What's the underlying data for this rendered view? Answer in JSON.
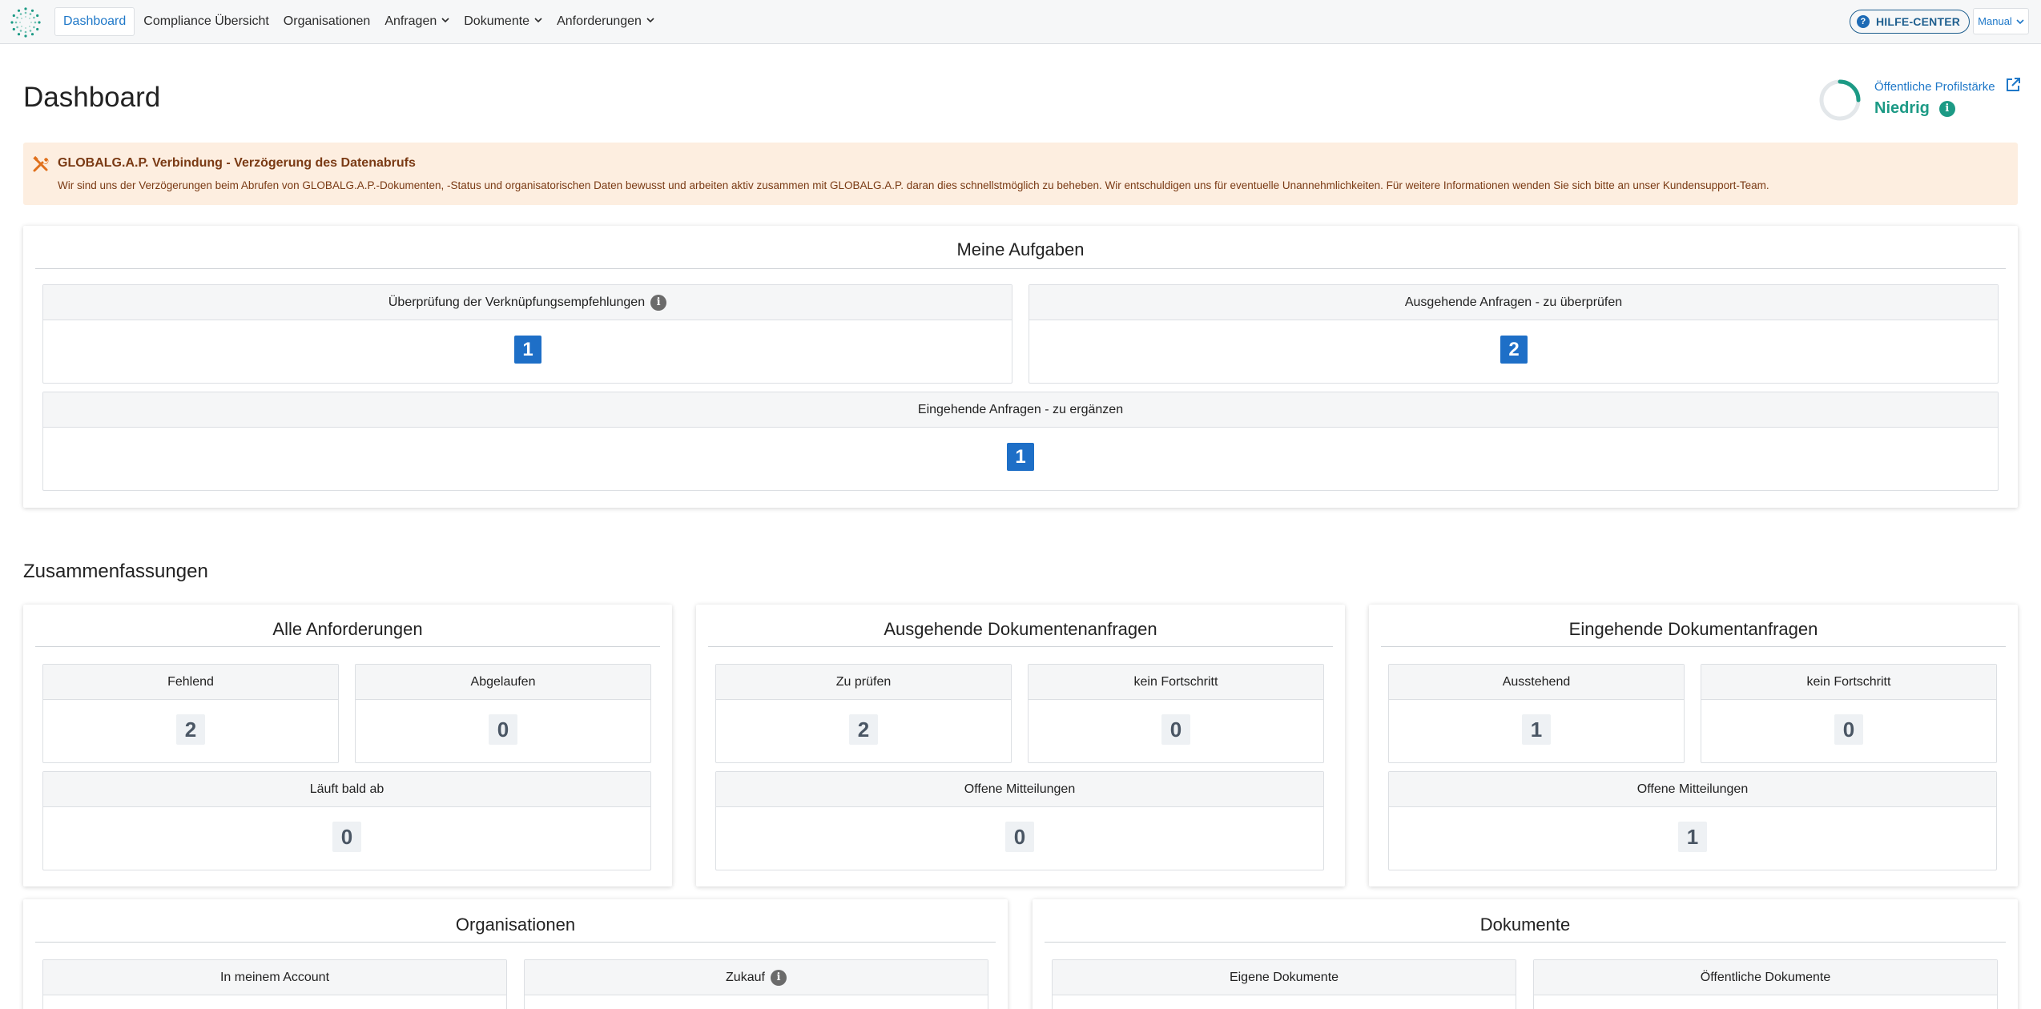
{
  "nav": {
    "items": [
      {
        "label": "Dashboard"
      },
      {
        "label": "Compliance Übersicht"
      },
      {
        "label": "Organisationen"
      },
      {
        "label": "Anfragen"
      },
      {
        "label": "Dokumente"
      },
      {
        "label": "Anforderungen"
      }
    ],
    "help_label": "HILFE-CENTER",
    "help_icon": "?",
    "manual_label": "Manual"
  },
  "header": {
    "title": "Dashboard",
    "profile_link": "Öffentliche Profilstärke",
    "profile_level": "Niedrig",
    "profile_progress": 0.25,
    "info_glyph": "i"
  },
  "alert": {
    "title": "GLOBALG.A.P. Verbindung - Verzögerung des Datenabrufs",
    "text": "Wir sind uns der Verzögerungen beim Abrufen von GLOBALG.A.P.-Dokumenten, -Status und organisatorischen Daten bewusst und arbeiten aktiv zusammen mit GLOBALG.A.P. daran dies schnellstmöglich zu beheben. Wir entschuldigen uns für eventuelle Unannehmlichkeiten. Für weitere Informationen wenden Sie sich bitte an unser Kundensupport-Team."
  },
  "tasks": {
    "title": "Meine Aufgaben",
    "tiles": [
      {
        "label": "Überprüfung der Verknüpfungsempfehlungen",
        "value": "1"
      },
      {
        "label": "Ausgehende Anfragen - zu überprüfen",
        "value": "2"
      },
      {
        "label": "Eingehende Anfragen - zu ergänzen",
        "value": "1"
      }
    ]
  },
  "summaries": {
    "title": "Zusammenfassungen",
    "all_requirements": {
      "title": "Alle Anforderungen",
      "tiles": [
        {
          "label": "Fehlend",
          "value": "2"
        },
        {
          "label": "Abgelaufen",
          "value": "0"
        },
        {
          "label": "Läuft bald ab",
          "value": "0"
        }
      ]
    },
    "outgoing_requests": {
      "title": "Ausgehende Dokumentenanfragen",
      "tiles": [
        {
          "label": "Zu prüfen",
          "value": "2"
        },
        {
          "label": "kein Fortschritt",
          "value": "0"
        },
        {
          "label": "Offene Mitteilungen",
          "value": "0"
        }
      ]
    },
    "incoming_requests": {
      "title": "Eingehende Dokumentanfragen",
      "tiles": [
        {
          "label": "Ausstehend",
          "value": "1"
        },
        {
          "label": "kein Fortschritt",
          "value": "0"
        },
        {
          "label": "Offene Mitteilungen",
          "value": "1"
        }
      ]
    },
    "organisations": {
      "title": "Organisationen",
      "tiles": [
        {
          "label": "In meinem Account"
        },
        {
          "label": "Zukauf"
        }
      ]
    },
    "documents": {
      "title": "Dokumente",
      "tiles": [
        {
          "label": "Eigene Dokumente"
        },
        {
          "label": "Öffentliche Dokumente"
        }
      ]
    }
  },
  "colors": {
    "accent": "#1f78c8",
    "badge_blue": "#1e6fc7",
    "success": "#1c9a85",
    "alert_bg": "#fdeee0",
    "alert_text": "#7a3a14"
  },
  "icons": {
    "logo": "globalgap-logo",
    "alert": "tools-icon",
    "external": "external-link-icon",
    "info": "info-icon",
    "help": "question-icon"
  }
}
